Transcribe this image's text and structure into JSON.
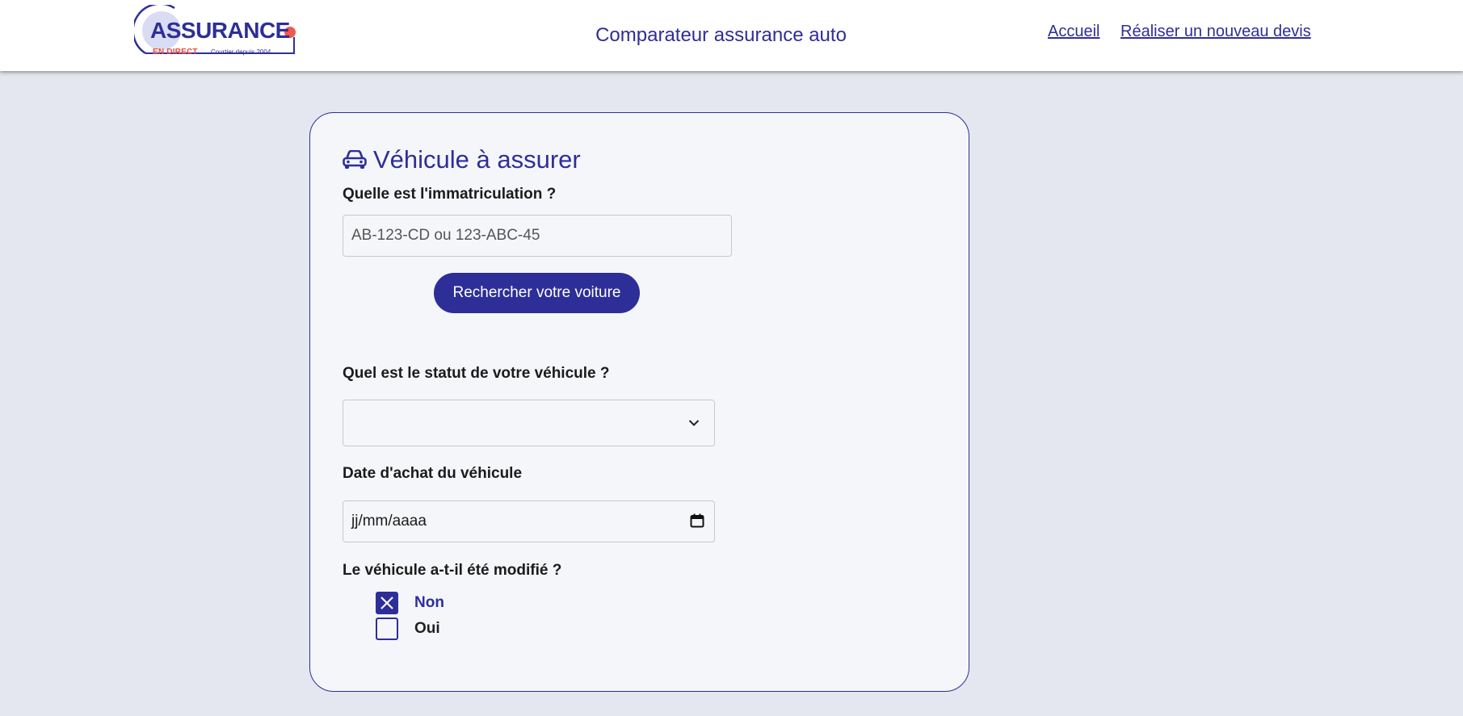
{
  "header": {
    "logo": {
      "word": "ASSURANCE",
      "tagline": "EN DIRECT",
      "since": "Courtier depuis 2004"
    },
    "title": "Comparateur assurance auto",
    "nav": {
      "home": "Accueil",
      "new_quote": "Réaliser un nouveau devis"
    }
  },
  "form": {
    "section_title": "Véhicule à assurer",
    "plate": {
      "label": "Quelle est l'immatriculation ?",
      "placeholder": "AB-123-CD ou 123-ABC-45",
      "value": ""
    },
    "search_button": "Rechercher votre voiture",
    "status": {
      "label": "Quel est le statut de votre véhicule ?",
      "selected": ""
    },
    "purchase_date": {
      "label": "Date d'achat du véhicule",
      "placeholder": "jj/mm/aaaa"
    },
    "modified": {
      "label": "Le véhicule a-t-il été modifié ?",
      "options": [
        {
          "label": "Non",
          "checked": true
        },
        {
          "label": "Oui",
          "checked": false
        }
      ]
    }
  },
  "colors": {
    "brand": "#2e2e98",
    "accent": "#e84a3a",
    "background": "#e4e7f0"
  },
  "icons": {
    "section": "car-icon",
    "select": "chevron-down-icon",
    "date": "calendar-icon",
    "checked": "close-icon"
  }
}
